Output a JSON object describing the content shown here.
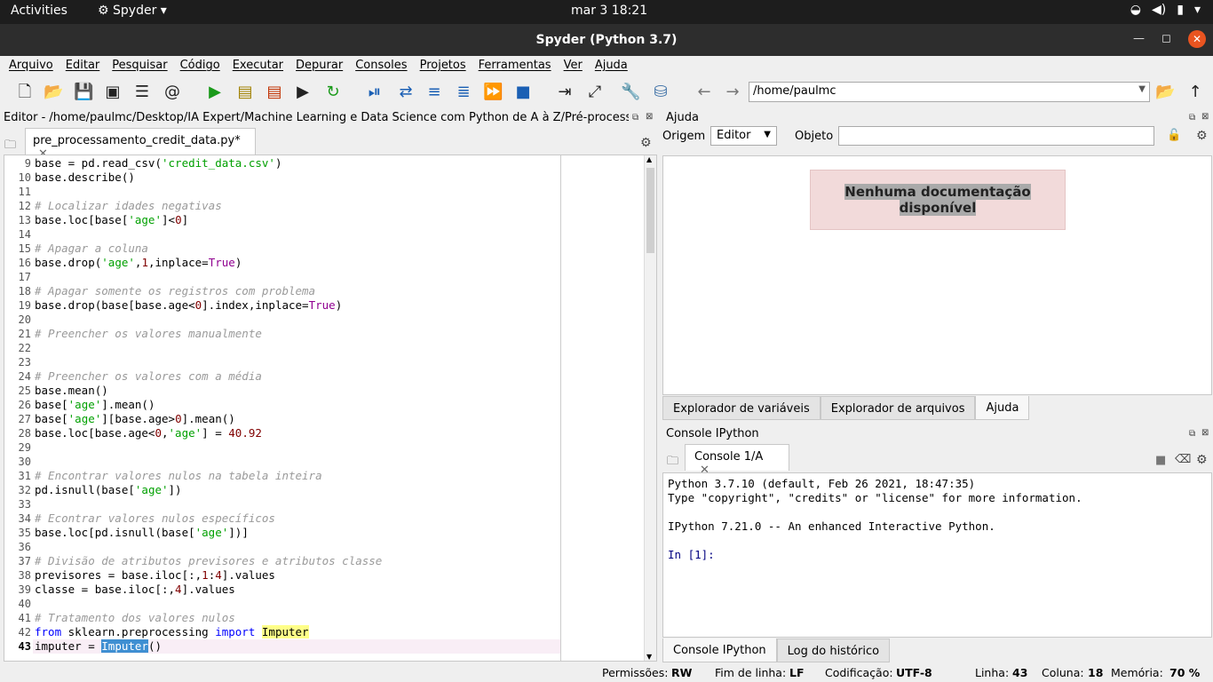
{
  "system": {
    "activities": "Activities",
    "app_name": "Spyder",
    "clock": "mar 3  18:21"
  },
  "window": {
    "title": "Spyder (Python 3.7)"
  },
  "menu": [
    "Arquivo",
    "Editar",
    "Pesquisar",
    "Código",
    "Executar",
    "Depurar",
    "Consoles",
    "Projetos",
    "Ferramentas",
    "Ver",
    "Ajuda"
  ],
  "toolbar": {
    "path": "/home/paulmc"
  },
  "editor": {
    "header": "Editor - /home/paulmc/Desktop/IA Expert/Machine Learning e Data Science com Python de A à Z/Pré-processament...",
    "tab_label": "pre_processamento_credit_data.py*",
    "current_line": 43
  },
  "help": {
    "header": "Ajuda",
    "origin_label": "Origem",
    "origin_value": "Editor",
    "object_label": "Objeto",
    "object_value": "",
    "no_doc_line1": "Nenhuma documentação",
    "no_doc_line2": "disponível",
    "tabs": [
      "Explorador de variáveis",
      "Explorador de arquivos",
      "Ajuda"
    ]
  },
  "console": {
    "header": "Console IPython",
    "tab_label": "Console 1/A",
    "lines": [
      "Python 3.7.10 (default, Feb 26 2021, 18:47:35)",
      "Type \"copyright\", \"credits\" or \"license\" for more information.",
      "",
      "IPython 7.21.0 -- An enhanced Interactive Python.",
      "",
      "In [1]:"
    ],
    "bottom_tabs": [
      "Console IPython",
      "Log do histórico"
    ]
  },
  "status": {
    "perm_label": "Permissões:",
    "perm": "RW",
    "eol_label": "Fim de linha:",
    "eol": "LF",
    "enc_label": "Codificação:",
    "enc": "UTF-8",
    "line_label": "Linha:",
    "line": "43",
    "col_label": "Coluna:",
    "col": "18",
    "mem_label": "Memória:",
    "mem": "70 %"
  }
}
